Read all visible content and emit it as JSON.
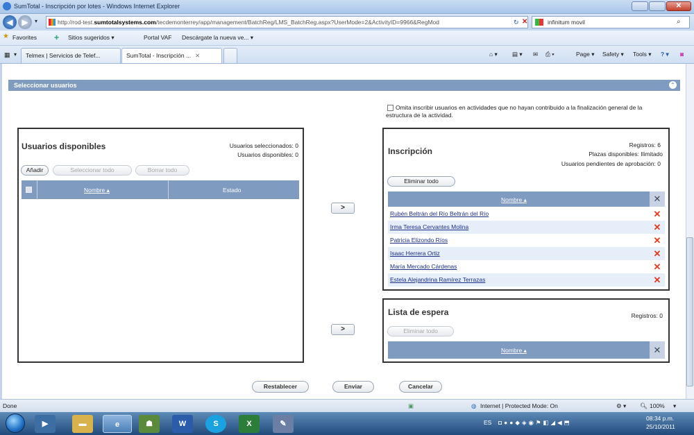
{
  "window": {
    "title": "SumTotal - Inscripción por lotes - Windows Internet Explorer"
  },
  "browser": {
    "url_prefix": "http://rod-test.",
    "url_domain": "sumtotalsystems.com",
    "url_path": "/tecdemonterrey/app/management/BatchReg/LMS_BatchReg.aspx?UserMode=2&ActivityID=9966&RegMod",
    "search_value": "infinitum movil",
    "favorites_label": "Favorites",
    "fav_items": [
      "Sitios sugeridos ▾",
      "Portal VAF",
      "Descárgate la nueva ve... ▾"
    ],
    "tabs": [
      "Telmex | Servicios de Telef...",
      "SumTotal - Inscripción ..."
    ],
    "commands": [
      "Page ▾",
      "Safety ▾",
      "Tools ▾"
    ]
  },
  "page": {
    "section_title": "Seleccionar usuarios",
    "omit_checkbox_label": "Omita inscribir usuarios en actividades que no hayan contribuido a la finalización general de la estructura de la actividad.",
    "available": {
      "title": "Usuarios disponibles",
      "selected_label": "Usuarios seleccionados: 0",
      "available_label": "Usuarios disponibles: 0",
      "add_button": "Añadir",
      "select_all_button": "Seleccionar todo",
      "clear_all_button": "Borrar todo",
      "col_name": "Nombre ▴",
      "col_status": "Estado"
    },
    "arrow_label": ">",
    "enrollment": {
      "title": "Inscripción",
      "records": "Registros: 6",
      "seats": "Plazas disponibles: Ilimitado",
      "pending": "Usuarios pendientes de aprobación: 0",
      "remove_all_button": "Eliminar todo",
      "col_name": "Nombre ▴",
      "users": [
        "Rubén Beltrán del Río Beltrán del Río",
        "Irma Teresa Cervantes Molina",
        "Patricia Elizondo Ríos",
        "Isaac Herrera Ortiz",
        "María Mercado Cárdenas",
        "Estela Alejandrina Ramírez Terrazas"
      ]
    },
    "waitlist": {
      "title": "Lista de espera",
      "records": "Registros: 0",
      "remove_all_button": "Eliminar todo",
      "col_name": "Nombre ▴"
    },
    "footer_buttons": {
      "reset": "Restablecer",
      "send": "Enviar",
      "cancel": "Cancelar"
    }
  },
  "statusbar": {
    "left": "Done",
    "zone": "Internet | Protected Mode: On",
    "zoom": "100%"
  },
  "taskbar": {
    "lang": "ES",
    "time": "08:34 p.m.",
    "date": "25/10/2011"
  },
  "colors": {
    "header_blue": "#7f9bc0",
    "delete_red": "#e43a1c",
    "link_blue": "#1b2e86"
  }
}
